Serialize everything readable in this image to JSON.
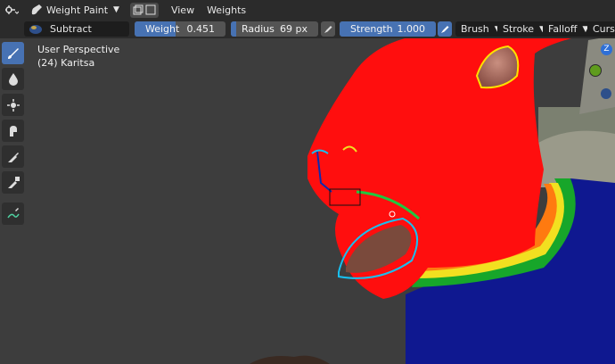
{
  "header": {
    "mode_label": "Weight Paint",
    "menus": [
      "View",
      "Weights"
    ]
  },
  "toolbar": {
    "blend_mode": "Subtract",
    "weight": {
      "label": "Weight",
      "value": "0.451",
      "fraction": 0.451
    },
    "radius": {
      "label": "Radius",
      "value": "69 px",
      "fraction": 0.06
    },
    "strength": {
      "label": "Strength",
      "value": "1.000",
      "fraction": 1.0
    },
    "dropdowns": [
      "Brush",
      "Stroke",
      "Falloff",
      "Cursor"
    ]
  },
  "tools": [
    {
      "name": "draw-brush-icon",
      "active": true
    },
    {
      "name": "blur-drop-icon",
      "active": false
    },
    {
      "name": "average-icon",
      "active": false
    },
    {
      "name": "smear-icon",
      "active": false
    },
    {
      "name": "sample-weight-icon",
      "active": false
    },
    {
      "name": "sample-group-icon",
      "active": false
    },
    {
      "name": "annotate-icon",
      "active": false
    }
  ],
  "viewport": {
    "view_name": "User Perspective",
    "object_info": "(24) Karitsa"
  },
  "gizmo": {
    "z_label": "Z"
  },
  "colors": {
    "accent": "#4772b3",
    "weight_red": "#ff0e0e",
    "weight_blue": "#0f1890",
    "header_bg": "#2b2b2b",
    "viewport_bg": "#3d3d3d"
  }
}
